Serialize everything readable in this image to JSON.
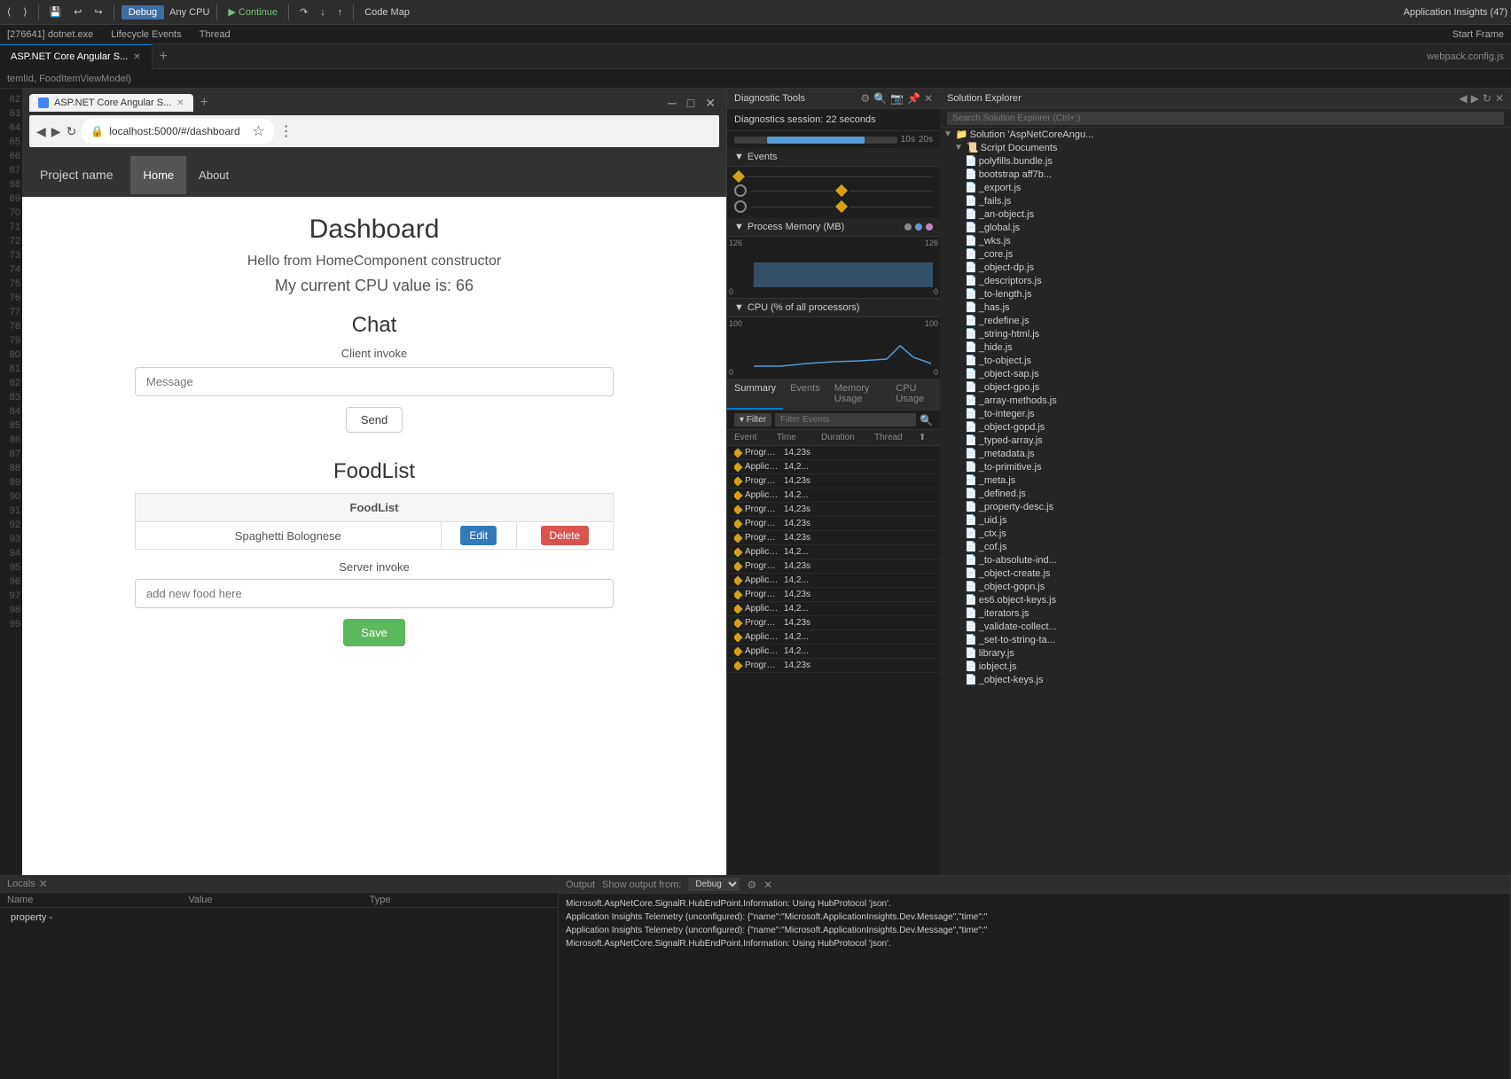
{
  "toolbar": {
    "debug_label": "Debug",
    "cpu_label": "Any CPU",
    "continue_label": "Continue",
    "code_map_label": "Code Map",
    "app_insights_label": "Application Insights (47)",
    "process_label": "[276641] dotnet.exe",
    "lifecycle_label": "Lifecycle Events",
    "thread_label": "Thread",
    "start_frame_label": "Start Frame"
  },
  "tabs": {
    "active_tab": "ASP.NET Core Angular S...",
    "address": "localhost:5000/#/dashboard"
  },
  "browser": {
    "title": "Dashboard",
    "subtitle": "Hello from HomeComponent constructor",
    "cpu_value": "My current CPU value is: 66",
    "chat_title": "Chat",
    "client_invoke_label": "Client invoke",
    "message_placeholder": "Message",
    "send_btn": "Send",
    "food_list_title": "FoodList",
    "food_list_header": "FoodList",
    "food_item": "Spaghetti Bolognese",
    "edit_btn": "Edit",
    "delete_btn": "Delete",
    "server_invoke_label": "Server invoke",
    "add_food_placeholder": "add new food here",
    "save_btn": "Save",
    "nav_brand": "Project name",
    "nav_home": "Home",
    "nav_about": "About"
  },
  "diagnostics": {
    "panel_title": "Diagnostic Tools",
    "session_label": "Diagnostics session: 22 seconds",
    "time_10s": "10s",
    "time_20s": "20s",
    "events_section": "Events",
    "memory_section": "Process Memory (MB)",
    "cpu_section": "CPU (% of all processors)",
    "memory_max": "126",
    "memory_min": "0",
    "cpu_max": "100",
    "cpu_min": "0",
    "tabs": [
      "Summary",
      "Events",
      "Memory Usage",
      "CPU Usage"
    ],
    "filter_btn": "▾ Filter",
    "filter_placeholder": "Filter Events",
    "columns": [
      "Event",
      "Time",
      "Duration",
      "Thread"
    ],
    "summary_tab": "Summary",
    "events_tab": "Events",
    "memory_tab": "Memory Usage",
    "cpu_tab": "CPU Usage"
  },
  "events": [
    {
      "name": "Program Output...",
      "time": "14,23s",
      "duration": "",
      "thread": ""
    },
    {
      "name": "Application Insigh...",
      "time": "14,2...",
      "duration": "",
      "thread": ""
    },
    {
      "name": "Program Output...",
      "time": "14,23s",
      "duration": "",
      "thread": ""
    },
    {
      "name": "Application Insigh...",
      "time": "14,2...",
      "duration": "",
      "thread": ""
    },
    {
      "name": "Program Output...",
      "time": "14,23s",
      "duration": "",
      "thread": ""
    },
    {
      "name": "Program Output...",
      "time": "14,23s",
      "duration": "",
      "thread": ""
    },
    {
      "name": "Program Output...",
      "time": "14,23s",
      "duration": "",
      "thread": ""
    },
    {
      "name": "Application Insigh...",
      "time": "14,2...",
      "duration": "",
      "thread": ""
    },
    {
      "name": "Program Output...",
      "time": "14,23s",
      "duration": "",
      "thread": ""
    },
    {
      "name": "Application Insigh...",
      "time": "14,2...",
      "duration": "",
      "thread": ""
    },
    {
      "name": "Program Output...",
      "time": "14,23s",
      "duration": "",
      "thread": ""
    },
    {
      "name": "Application Insigh...",
      "time": "14,2...",
      "duration": "",
      "thread": ""
    },
    {
      "name": "Program Output...",
      "time": "14,23s",
      "duration": "",
      "thread": ""
    },
    {
      "name": "Application Insigh...",
      "time": "14,2...",
      "duration": "",
      "thread": ""
    },
    {
      "name": "Application Insigh...",
      "time": "14,2...",
      "duration": "",
      "thread": ""
    },
    {
      "name": "Program Output...",
      "time": "14,23s",
      "duration": "",
      "thread": ""
    }
  ],
  "solution_explorer": {
    "title": "Solution Explorer",
    "search_placeholder": "Search Solution Explorer (Ctrl+;)",
    "solution_name": "Solution 'AspNetCoreAngu...",
    "script_docs": "Script Documents",
    "files": [
      "polyfills.bundle.js",
      "bootstrap aff7b...",
      "_export.js",
      "_fails.js",
      "_an-object.js",
      "_global.js",
      "_wks.js",
      "_core.js",
      "_object-dp.js",
      "_descriptors.js",
      "_to-length.js",
      "_has.js",
      "_redefine.js",
      "_string-html.js",
      "_hide.js",
      "_to-object.js",
      "_object-sap.js",
      "_object-gpo.js",
      "_array-methods.js",
      "_to-integer.js",
      "_object-gopd.js",
      "_typed-array.js",
      "_metadata.js",
      "_to-primitive.js",
      "_meta.js",
      "_defined.js",
      "_property-desc.js",
      "_uid.js",
      "_ctx.js",
      "_cof.js",
      "_to-absolute-ind...",
      "_object-create.js",
      "_object-gopn.js",
      "es6.object-keys.js",
      "_iterators.js",
      "_validate-collect...",
      "_set-to-string-ta...",
      "library.js",
      "iobject.js",
      "_object-keys.js"
    ]
  },
  "output": {
    "title": "Output",
    "source_label": "Show output from:",
    "source": "Debug",
    "lines": [
      "Microsoft.AspNetCore.SignalR.HubEndPoint.Information: Using HubProtocol 'json'.",
      "Application Insights Telemetry (unconfigured): {\"name\":\"Microsoft.ApplicationInsights.Dev.Message\",\"time\":\"",
      "Application Insights Telemetry (unconfigured): {\"name\":\"Microsoft.ApplicationInsights.Dev.Message\",\"time\":\"",
      "Microsoft.AspNetCore.SignalR.HubEndPoint.Information: Using HubProtocol 'json'."
    ]
  },
  "bottom_panel": {
    "name_col": "Name",
    "value_col": "Value",
    "type_col": "Type"
  },
  "webpack_header": "webpack.config.js",
  "breadcrumb": "temlId, FoodItemViewModel)",
  "property_text": "property -"
}
